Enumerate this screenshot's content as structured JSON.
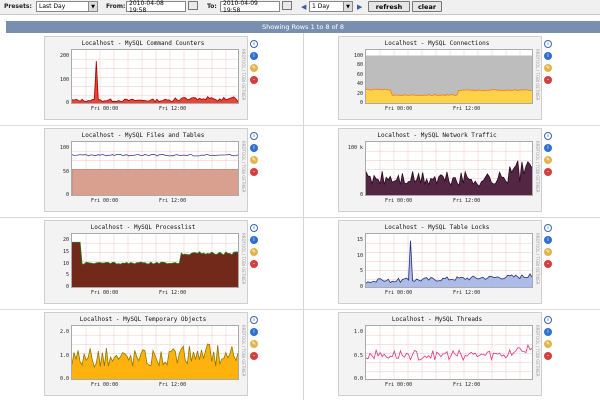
{
  "toolbar": {
    "presets_label": "Presets:",
    "presets_value": "Last Day",
    "from_label": "From:",
    "from_value": "2010-04-08 19:58",
    "to_label": "To:",
    "to_value": "2010-04-09 19:58",
    "span_value": "1 Day",
    "refresh_label": "refresh",
    "clear_label": "clear"
  },
  "pagebar": {
    "text": "Showing Rows 1 to 8 of 8"
  },
  "side_text": "RRDTOOL / TOBI OETIKER",
  "graphs": [
    {
      "id": "g1",
      "title": "Localhost - MySQL Command Counters",
      "yticks": [
        "200",
        "100",
        "0"
      ],
      "xticks": [
        "Fri 00:00",
        "Fri 12:00"
      ],
      "fill": "#e83a2a",
      "line": "#a00000",
      "bg_band": null
    },
    {
      "id": "g2",
      "title": "Localhost - MySQL Connections",
      "yticks": [
        "100",
        "80",
        "60",
        "40",
        "20",
        "0"
      ],
      "xticks": [
        "Fri 00:00",
        "Fri 12:00"
      ],
      "fill": "#ffd24a",
      "line": "#ff7a00",
      "bg_band": "#bdbdbd"
    },
    {
      "id": "g3",
      "title": "Localhost - MySQL Files and Tables",
      "yticks": [
        "100",
        "50",
        "0"
      ],
      "xticks": [
        "Fri 00:00",
        "Fri 12:00"
      ],
      "fill": "#d9a090",
      "line": "#3a3f8f",
      "bg_band": null
    },
    {
      "id": "g4",
      "title": "Localhost - MySQL Network Traffic",
      "yticks": [
        "100 k",
        "0"
      ],
      "xticks": [
        "Fri 00:00",
        "Fri 12:00"
      ],
      "fill": "#4a1a3a",
      "line": "#2a0a20",
      "bg_band": null
    },
    {
      "id": "g5",
      "title": "Localhost - MySQL Processlist",
      "yticks": [
        "20",
        "15",
        "10",
        "5",
        "0"
      ],
      "xticks": [
        "Fri 00:00",
        "Fri 12:00"
      ],
      "fill": "#6a1e0e",
      "line": "#2c7a1a",
      "bg_band": null
    },
    {
      "id": "g6",
      "title": "Localhost - MySQL Table Locks",
      "yticks": [
        "15",
        "10",
        "5",
        "0"
      ],
      "xticks": [
        "Fri 00:00",
        "Fri 12:00"
      ],
      "fill": "#a9b7e8",
      "line": "#22307a",
      "bg_band": null
    },
    {
      "id": "g7",
      "title": "Localhost - MySQL Temporary Objects",
      "yticks": [
        "2.0",
        "1.0",
        "0.0"
      ],
      "xticks": [
        "Fri 00:00",
        "Fri 12:00"
      ],
      "fill": "#ffae00",
      "line": "#8a7a00",
      "bg_band": null
    },
    {
      "id": "g8",
      "title": "Localhost - MySQL Threads",
      "yticks": [
        "1.0",
        "0.5",
        "0.0"
      ],
      "xticks": [
        "Fri 00:00",
        "Fri 12:00"
      ],
      "fill": "none",
      "line": "#e0337a",
      "bg_band": null
    }
  ]
}
